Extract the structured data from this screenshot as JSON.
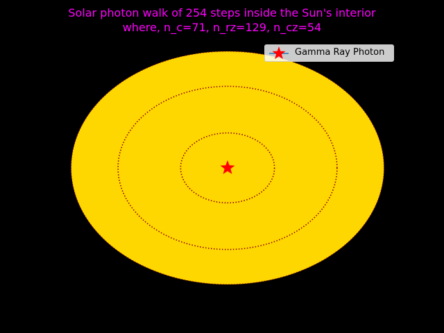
{
  "chart_data": {
    "type": "scatter",
    "title": "Solar photon walk of 254 steps inside the Sun's interior",
    "subtitle": "where, n_c=71, n_rz=129, n_cz=54",
    "xlabel": "",
    "ylabel": "",
    "axes_visible": false,
    "grid": false,
    "legend_placement": "upper right",
    "background_color": "#000000",
    "title_color": "#ff00ff",
    "sun_color": "#ffd700",
    "boundary_color": "#8b0000",
    "boundary_style": "dotted",
    "xlim": [
      -1.0,
      1.0
    ],
    "ylim": [
      -1.0,
      1.0
    ],
    "zones": [
      {
        "radius": 1.0
      },
      {
        "radius": 0.7
      },
      {
        "radius": 0.3
      }
    ],
    "series": [
      {
        "name": "Gamma Ray Photon",
        "marker": "star",
        "marker_color": "#ff0000",
        "line_color": "#1f77b4",
        "x": [
          0.0
        ],
        "y": [
          0.0
        ]
      }
    ]
  }
}
